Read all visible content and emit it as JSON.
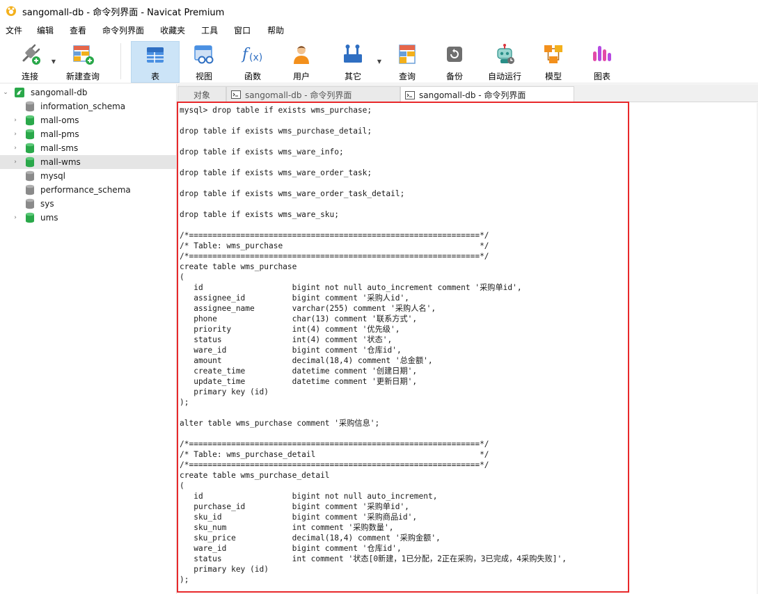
{
  "window": {
    "title": "sangomall-db - 命令列界面 - Navicat Premium"
  },
  "menu": [
    "文件",
    "编辑",
    "查看",
    "命令列界面",
    "收藏夹",
    "工具",
    "窗口",
    "帮助"
  ],
  "toolbar": {
    "connect": "连接",
    "new_query": "新建查询",
    "table": "表",
    "view": "视图",
    "function": "函数",
    "user": "用户",
    "other": "其它",
    "query": "查询",
    "backup": "备份",
    "auto_run": "自动运行",
    "model": "模型",
    "chart": "图表"
  },
  "sidebar": {
    "connection": "sangomall-db",
    "databases": [
      {
        "name": "information_schema",
        "active": false,
        "expandable": false
      },
      {
        "name": "mall-oms",
        "active": true,
        "expandable": true
      },
      {
        "name": "mall-pms",
        "active": true,
        "expandable": true
      },
      {
        "name": "mall-sms",
        "active": true,
        "expandable": true
      },
      {
        "name": "mall-wms",
        "active": true,
        "expandable": true,
        "selected": true
      },
      {
        "name": "mysql",
        "active": false,
        "expandable": false
      },
      {
        "name": "performance_schema",
        "active": false,
        "expandable": false
      },
      {
        "name": "sys",
        "active": false,
        "expandable": false
      },
      {
        "name": "ums",
        "active": true,
        "expandable": true
      }
    ]
  },
  "tabs": {
    "objects": "对象",
    "tab1": "sangomall-db - 命令列界面",
    "tab2": "sangomall-db - 命令列界面"
  },
  "console": {
    "text": "mysql> drop table if exists wms_purchase;\n\ndrop table if exists wms_purchase_detail;\n\ndrop table if exists wms_ware_info;\n\ndrop table if exists wms_ware_order_task;\n\ndrop table if exists wms_ware_order_task_detail;\n\ndrop table if exists wms_ware_sku;\n\n/*==============================================================*/\n/* Table: wms_purchase                                          */\n/*==============================================================*/\ncreate table wms_purchase\n(\n   id                   bigint not null auto_increment comment '采购单id',\n   assignee_id          bigint comment '采购人id',\n   assignee_name        varchar(255) comment '采购人名',\n   phone                char(13) comment '联系方式',\n   priority             int(4) comment '优先级',\n   status               int(4) comment '状态',\n   ware_id              bigint comment '仓库id',\n   amount               decimal(18,4) comment '总金额',\n   create_time          datetime comment '创建日期',\n   update_time          datetime comment '更新日期',\n   primary key (id)\n);\n\nalter table wms_purchase comment '采购信息';\n\n/*==============================================================*/\n/* Table: wms_purchase_detail                                   */\n/*==============================================================*/\ncreate table wms_purchase_detail\n(\n   id                   bigint not null auto_increment,\n   purchase_id          bigint comment '采购单id',\n   sku_id               bigint comment '采购商品id',\n   sku_num              int comment '采购数量',\n   sku_price            decimal(18,4) comment '采购金额',\n   ware_id              bigint comment '仓库id',\n   status               int comment '状态[0新建，1已分配，2正在采购，3已完成，4采购失败]',\n   primary key (id)\n);"
  },
  "colors": {
    "highlight": "#e8282a",
    "db_active": "#2aa84a",
    "db_inactive": "#8a8a8a",
    "selected_row": "#e5e5e5",
    "active_tool": "#cce4f7"
  }
}
